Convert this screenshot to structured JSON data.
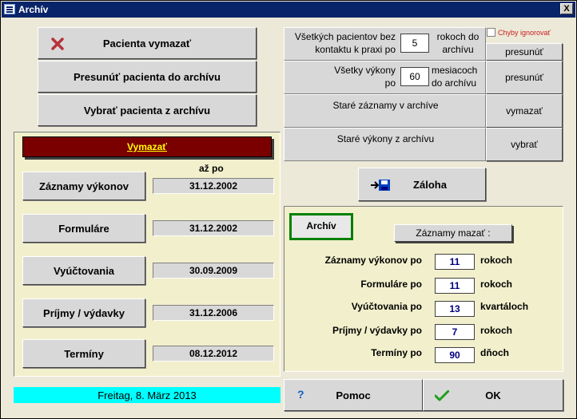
{
  "window": {
    "title": "Archív",
    "close": "X"
  },
  "left_buttons": {
    "delete_patient": "Pacienta vymazať",
    "move_to_archive": "Presunúť pacienta do archívu",
    "select_from_archive": "Vybrať pacienta z archívu"
  },
  "delete_panel": {
    "header": "Vymazať",
    "until_label": "až po",
    "rows": [
      {
        "label": "Záznamy výkonov",
        "date": "31.12.2002"
      },
      {
        "label": "Formuláre",
        "date": "31.12.2002"
      },
      {
        "label": "Vyúčtovania",
        "date": "30.09.2009"
      },
      {
        "label": "Príjmy / výdavky",
        "date": "31.12.2006"
      },
      {
        "label": "Termíny",
        "date": "08.12.2012"
      }
    ]
  },
  "status_date": "Freitag, 8. März 2013",
  "top_grid": {
    "row1": {
      "text_a": "Všetkých pacientov bez",
      "text_b": "kontaktu k praxi po",
      "value": "5",
      "suffix_a": "rokoch do",
      "suffix_b": "archívu",
      "button": "presunúť"
    },
    "row2": {
      "text_a": "Všetky výkony",
      "text_b": "po",
      "value": "60",
      "suffix_a": "mesiacoch",
      "suffix_b": "do archívu",
      "button": "presunúť"
    },
    "row3": {
      "text": "Staré záznamy v archíve",
      "button": "vymazať"
    },
    "row4": {
      "text": "Staré výkony z archívu",
      "button": "vybrať"
    },
    "ignore_errors": "Chyby ignorovať"
  },
  "backup_button": "Záloha",
  "archive_panel": {
    "tab_label": "Archív",
    "delete_records_label": "Záznamy mazať :",
    "rows": [
      {
        "label": "Záznamy výkonov po",
        "value": "11",
        "unit": "rokoch"
      },
      {
        "label": "Formuláre po",
        "value": "11",
        "unit": "rokoch"
      },
      {
        "label": "Vyúčtovania po",
        "value": "13",
        "unit": "kvartáloch"
      },
      {
        "label": "Príjmy / výdavky po",
        "value": "7",
        "unit": "rokoch"
      },
      {
        "label": "Termíny po",
        "value": "90",
        "unit": "dňoch"
      }
    ]
  },
  "bottom_buttons": {
    "help": "Pomoc",
    "ok": "OK"
  },
  "colors": {
    "title_bar": "#0a246a",
    "panel_bg": "#f2f0cc",
    "header_bg": "#7a0000",
    "header_text": "#ffff00",
    "status_bg": "#00ffff",
    "value_text": "#000080"
  }
}
